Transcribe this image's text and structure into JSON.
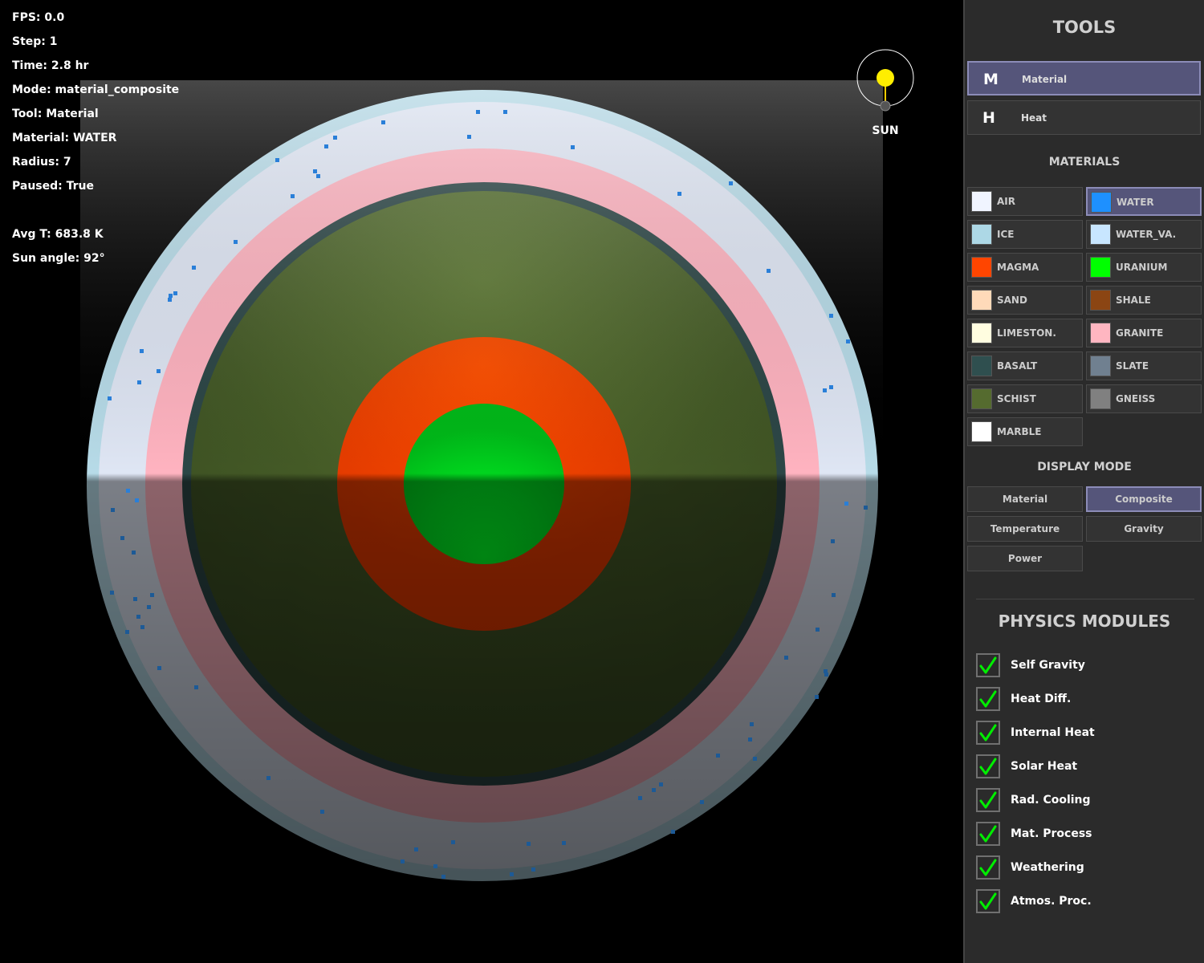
{
  "hud": {
    "fps": "FPS: 0.0",
    "step": "Step: 1",
    "time": "Time: 2.8 hr",
    "mode": "Mode: material_composite",
    "tool": "Tool: Material",
    "material": "Material: WATER",
    "radius": "Radius: 7",
    "paused": "Paused: True",
    "avg_temp": "Avg T: 683.8 K",
    "sun_angle": "Sun angle: 92°"
  },
  "sun": {
    "label": "SUN",
    "color": "#ffee00"
  },
  "panel": {
    "tools_title": "TOOLS",
    "tools": [
      {
        "key": "M",
        "label": "Material",
        "selected": true
      },
      {
        "key": "H",
        "label": "Heat",
        "selected": false
      }
    ],
    "materials_title": "MATERIALS",
    "materials": [
      {
        "label": "AIR",
        "color": "#f0f4ff",
        "selected": false
      },
      {
        "label": "WATER",
        "color": "#1e90ff",
        "selected": true
      },
      {
        "label": "ICE",
        "color": "#add8e6",
        "selected": false
      },
      {
        "label": "WATER_VA.",
        "color": "#c8e6ff",
        "selected": false
      },
      {
        "label": "MAGMA",
        "color": "#ff4500",
        "selected": false
      },
      {
        "label": "URANIUM",
        "color": "#00ff00",
        "selected": false
      },
      {
        "label": "SAND",
        "color": "#ffdab9",
        "selected": false
      },
      {
        "label": "SHALE",
        "color": "#8b4513",
        "selected": false
      },
      {
        "label": "LIMESTON.",
        "color": "#fffde0",
        "selected": false
      },
      {
        "label": "GRANITE",
        "color": "#ffb6c1",
        "selected": false
      },
      {
        "label": "BASALT",
        "color": "#2f4f4f",
        "selected": false
      },
      {
        "label": "SLATE",
        "color": "#708090",
        "selected": false
      },
      {
        "label": "SCHIST",
        "color": "#556b2f",
        "selected": false
      },
      {
        "label": "GNEISS",
        "color": "#808080",
        "selected": false
      },
      {
        "label": "MARBLE",
        "color": "#ffffff",
        "selected": false
      }
    ],
    "display_title": "DISPLAY MODE",
    "display_modes": [
      {
        "label": "Material",
        "selected": false
      },
      {
        "label": "Composite",
        "selected": true
      },
      {
        "label": "Temperature",
        "selected": false
      },
      {
        "label": "Gravity",
        "selected": false
      },
      {
        "label": "Power",
        "selected": false
      }
    ],
    "physics_title": "PHYSICS MODULES",
    "modules": [
      {
        "label": "Self Gravity",
        "enabled": true
      },
      {
        "label": "Heat Diff.",
        "enabled": true
      },
      {
        "label": "Internal Heat",
        "enabled": true
      },
      {
        "label": "Solar Heat",
        "enabled": true
      },
      {
        "label": "Rad. Cooling",
        "enabled": true
      },
      {
        "label": "Mat. Process",
        "enabled": true
      },
      {
        "label": "Weathering",
        "enabled": true
      },
      {
        "label": "Atmos. Proc.",
        "enabled": true
      }
    ],
    "check_color": "#00ee00"
  }
}
